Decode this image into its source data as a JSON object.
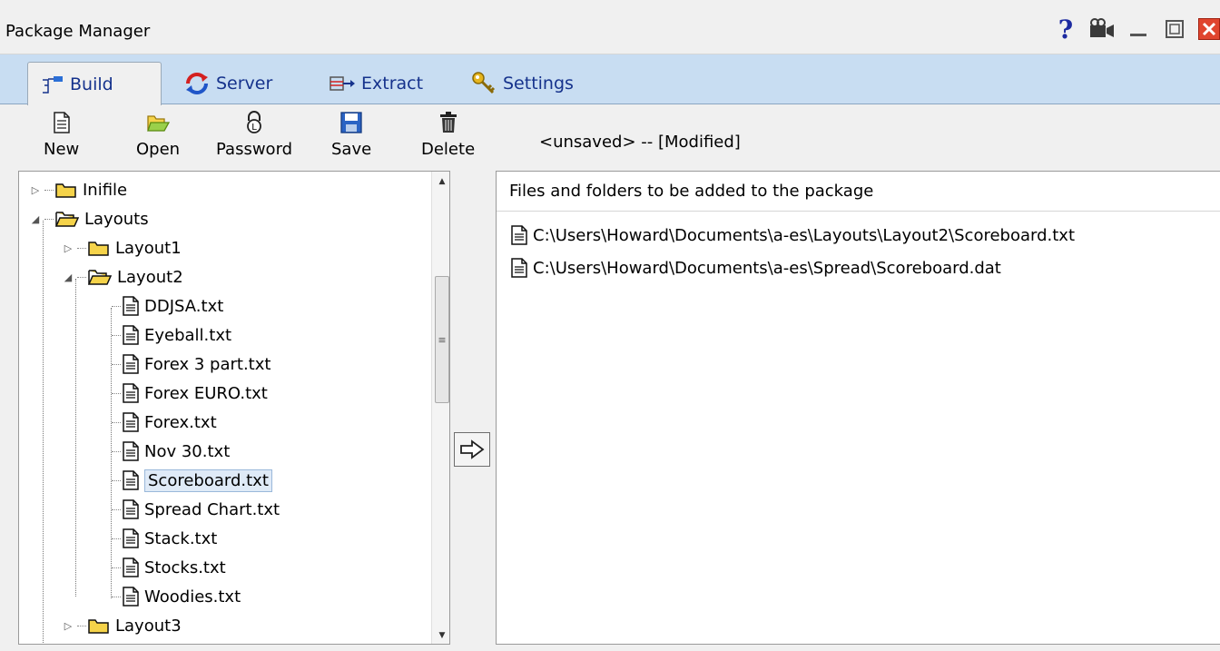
{
  "window": {
    "title": "Package Manager"
  },
  "window_controls": [
    "help-icon",
    "camera-icon",
    "minimize-icon",
    "maximize-icon",
    "close-icon"
  ],
  "tabs": [
    {
      "label": "Build",
      "icon": "build-icon",
      "active": true
    },
    {
      "label": "Server",
      "icon": "refresh-icon",
      "active": false
    },
    {
      "label": "Extract",
      "icon": "extract-icon",
      "active": false
    },
    {
      "label": "Settings",
      "icon": "key-icon",
      "active": false
    }
  ],
  "toolbar": {
    "new_label": "New",
    "open_label": "Open",
    "password_label": "Password",
    "save_label": "Save",
    "delete_label": "Delete"
  },
  "status": {
    "text": "<unsaved> -- [Modified]"
  },
  "tree": {
    "items": [
      {
        "label": "Inifile",
        "type": "folder",
        "expander": "▷"
      },
      {
        "label": "Layouts",
        "type": "folder-open",
        "expander": "◢"
      },
      {
        "label": "Layout1",
        "type": "folder",
        "expander": "▷"
      },
      {
        "label": "Layout2",
        "type": "folder-open",
        "expander": "◢"
      },
      {
        "label": "DDJSA.txt",
        "type": "file"
      },
      {
        "label": "Eyeball.txt",
        "type": "file"
      },
      {
        "label": "Forex 3 part.txt",
        "type": "file"
      },
      {
        "label": "Forex EURO.txt",
        "type": "file"
      },
      {
        "label": "Forex.txt",
        "type": "file"
      },
      {
        "label": "Nov 30.txt",
        "type": "file"
      },
      {
        "label": "Scoreboard.txt",
        "type": "file",
        "selected": true
      },
      {
        "label": "Spread Chart.txt",
        "type": "file"
      },
      {
        "label": "Stack.txt",
        "type": "file"
      },
      {
        "label": "Stocks.txt",
        "type": "file"
      },
      {
        "label": "Woodies.txt",
        "type": "file"
      },
      {
        "label": "Layout3",
        "type": "folder",
        "expander": "▷"
      }
    ]
  },
  "filelist": {
    "header": "Files and folders to be added to the package",
    "items": [
      "C:\\Users\\Howard\\Documents\\a-es\\Layouts\\Layout2\\Scoreboard.txt",
      "C:\\Users\\Howard\\Documents\\a-es\\Spread\\Scoreboard.dat"
    ]
  },
  "colors": {
    "tab_strip": "#c8ddf2",
    "tab_text": "#15328c",
    "selection": "#dfeaf7",
    "folder": "#f5d34a"
  }
}
